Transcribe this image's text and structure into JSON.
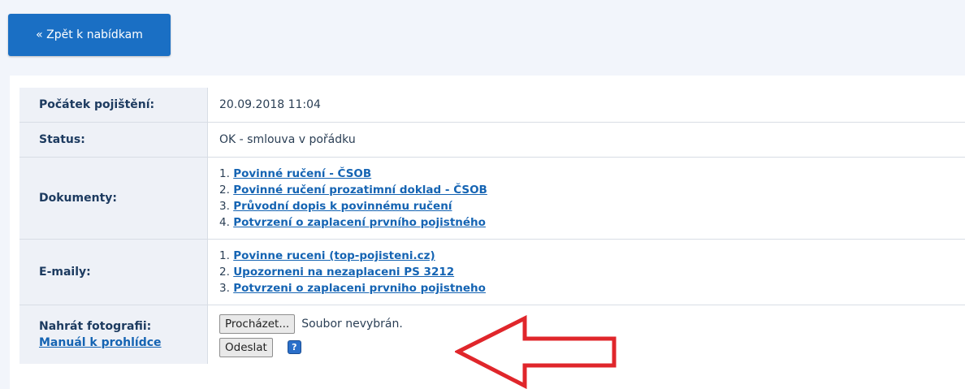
{
  "back_button": {
    "label": "« Zpět k nabídkam"
  },
  "details": {
    "start": {
      "label": "Počátek pojištění:",
      "value": "20.09.2018 11:04"
    },
    "status": {
      "label": "Status:",
      "value": "OK - smlouva v pořádku"
    },
    "documents": {
      "label": "Dokumenty:",
      "items": [
        {
          "num": "1.",
          "text": "Povinné ručení - ČSOB"
        },
        {
          "num": "2.",
          "text": "Povinné ručení prozatimní doklad - ČSOB"
        },
        {
          "num": "3.",
          "text": "Průvodní dopis k povinnému ručení"
        },
        {
          "num": "4.",
          "text": "Potvrzení o zaplacení prvního pojistného"
        }
      ]
    },
    "emails": {
      "label": "E-maily:",
      "items": [
        {
          "num": "1.",
          "text": "Povinne ruceni (top-pojisteni.cz)"
        },
        {
          "num": "2.",
          "text": "Upozorneni na nezaplaceni PS 3212"
        },
        {
          "num": "3.",
          "text": "Potvrzeni o zaplaceni prvniho pojistneho"
        }
      ]
    },
    "upload": {
      "label": "Nahrát fotografii:",
      "manual_link": "Manuál k prohlídce",
      "browse_label": "Procházet...",
      "file_status": "Soubor nevybrán.",
      "submit_label": "Odeslat",
      "help_icon": "?"
    }
  },
  "colors": {
    "accent": "#1a6fc4",
    "link": "#1564b3",
    "arrow": "#e0262b",
    "label_bg": "#eef1f7"
  },
  "icons": {
    "help": "question-mark-icon",
    "annotation": "red-arrow-left"
  }
}
